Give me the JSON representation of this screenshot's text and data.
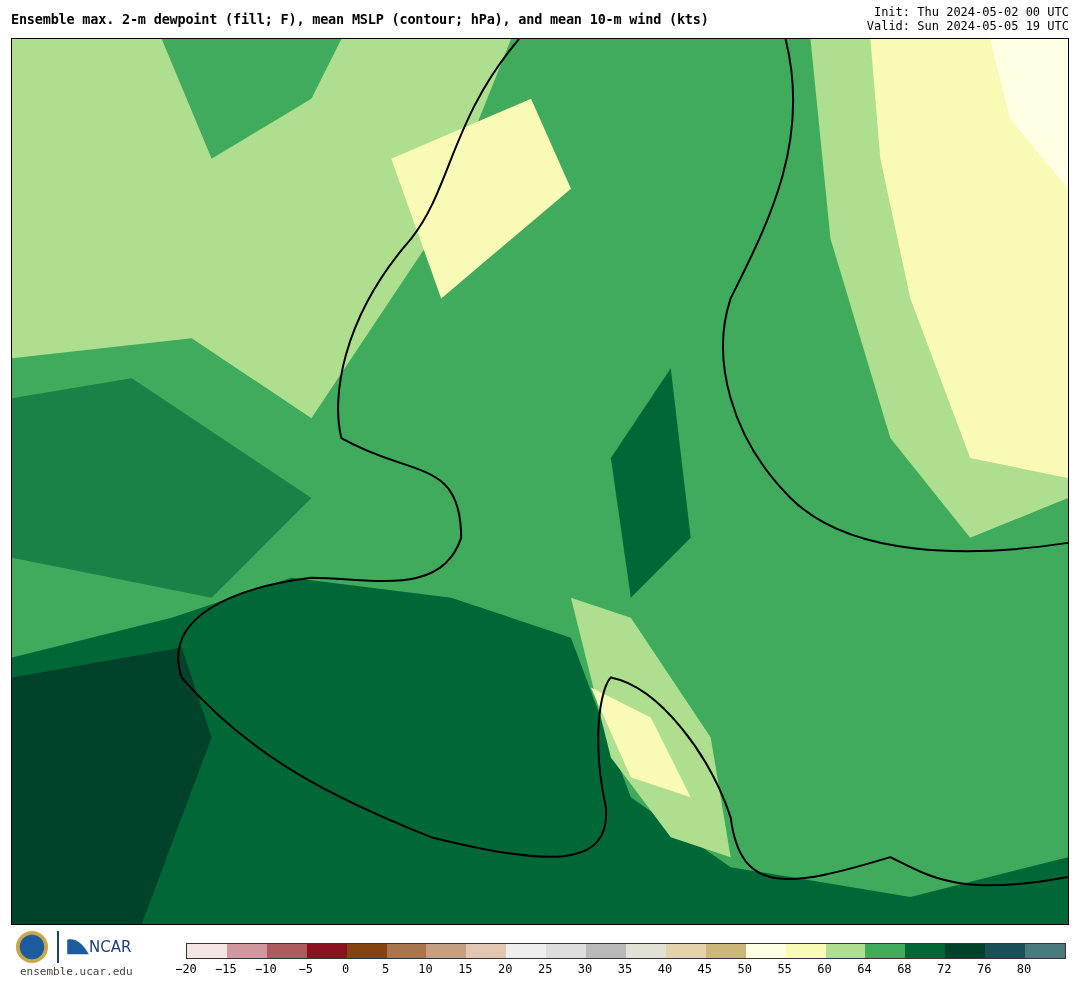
{
  "title": "Ensemble max. 2-m dewpoint (fill; F), mean MSLP (contour; hPa), and mean 10-m wind (kts)",
  "init": "Init: Thu 2024-05-02 00 UTC",
  "valid": "Valid: Sun 2024-05-05 19 UTC",
  "footer": {
    "site": "ensemble.ucar.edu",
    "logo_text": "NCAR"
  },
  "colorbar": {
    "segments": [
      {
        "color": "#f5e6e6"
      },
      {
        "color": "#d0989e"
      },
      {
        "color": "#ad5a61"
      },
      {
        "color": "#8a111e"
      },
      {
        "color": "#86420f"
      },
      {
        "color": "#a8754f"
      },
      {
        "color": "#c59f81"
      },
      {
        "color": "#e1c6b2"
      },
      {
        "color": "#eeeeee"
      },
      {
        "color": "#dddddd"
      },
      {
        "color": "#b9b9b9"
      },
      {
        "color": "#e1e2d4"
      },
      {
        "color": "#e2d3ae"
      },
      {
        "color": "#cbb77a"
      },
      {
        "color": "#ffffe3"
      },
      {
        "color": "#f8fab6"
      },
      {
        "color": "#addf8e"
      },
      {
        "color": "#41ab5d"
      },
      {
        "color": "#006837"
      },
      {
        "color": "#00432a"
      },
      {
        "color": "#1a4f56"
      },
      {
        "color": "#4a7a7b"
      }
    ],
    "ticks": [
      "−20",
      "−15",
      "−10",
      "−5",
      "0",
      "5",
      "10",
      "15",
      "20",
      "25",
      "30",
      "35",
      "40",
      "45",
      "50",
      "55",
      "60",
      "64",
      "68",
      "72",
      "76",
      "80"
    ]
  }
}
